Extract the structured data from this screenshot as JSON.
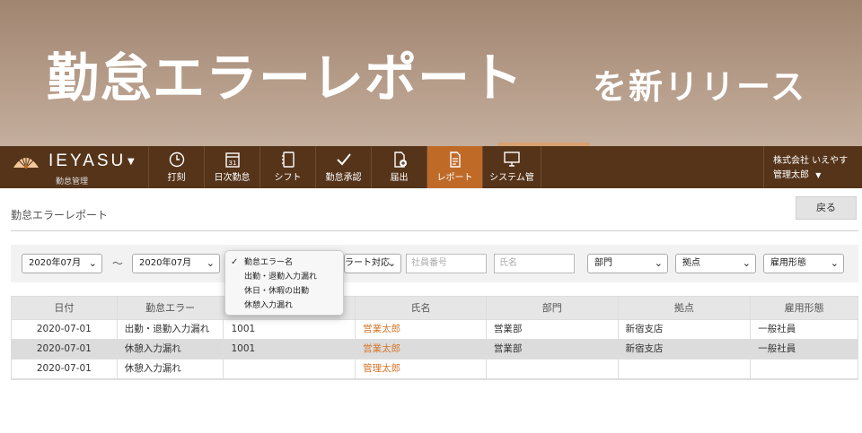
{
  "banner": {
    "title": "勤怠エラーレポート",
    "subtitle": "を新リリース"
  },
  "nav": {
    "logo_text": "IEYASU",
    "logo_sub": "勤怠管理",
    "items": [
      {
        "label": "打刻",
        "icon": "clock-icon"
      },
      {
        "label": "日次勤怠",
        "icon": "calendar-icon"
      },
      {
        "label": "シフト",
        "icon": "notebook-icon"
      },
      {
        "label": "勤怠承認",
        "icon": "checkmark-icon"
      },
      {
        "label": "届出",
        "icon": "document-add-icon"
      },
      {
        "label": "レポート",
        "icon": "report-icon"
      },
      {
        "label": "システム管",
        "icon": "monitor-icon"
      }
    ],
    "company": "株式会社 いえやす",
    "user": "管理太郎"
  },
  "page": {
    "title": "勤怠エラーレポート",
    "back_label": "戻る"
  },
  "filters": {
    "from_month": "2020年07月",
    "tilde": "〜",
    "to_month": "2020年07月",
    "error_type_partial": "ラート対応",
    "employee_no_placeholder": "社員番号",
    "name_placeholder": "氏名",
    "department": "部門",
    "base": "拠点",
    "employment_type": "雇用形態"
  },
  "dropdown": {
    "options": [
      "勤怠エラー名",
      "出勤・退勤入力漏れ",
      "休日・休暇の出勤",
      "休憩入力漏れ"
    ]
  },
  "table": {
    "headers": [
      "日付",
      "勤怠エラー",
      "",
      "氏名",
      "部門",
      "拠点",
      "雇用形態"
    ],
    "rows": [
      [
        "2020-07-01",
        "出勤・退勤入力漏れ",
        "1001",
        "営業太郎",
        "営業部",
        "新宿支店",
        "一般社員"
      ],
      [
        "2020-07-01",
        "休憩入力漏れ",
        "1001",
        "営業太郎",
        "営業部",
        "新宿支店",
        "一般社員"
      ],
      [
        "2020-07-01",
        "休憩入力漏れ",
        "",
        "管理太郎",
        "",
        "",
        ""
      ]
    ]
  },
  "colors": {
    "nav_bg": "#55341a",
    "active_tab": "#c06a28",
    "link": "#d4762a",
    "banner": "#a08570"
  }
}
